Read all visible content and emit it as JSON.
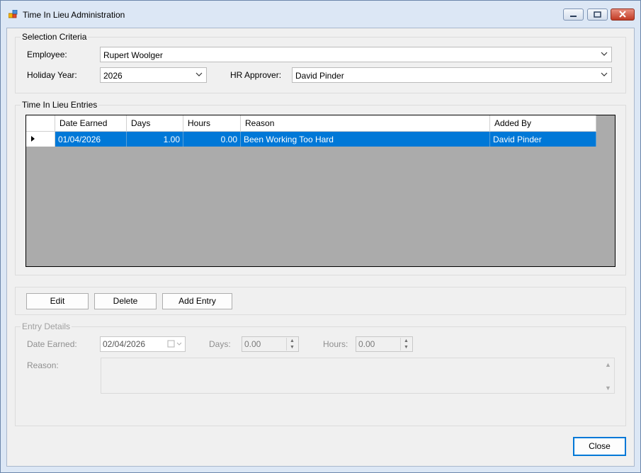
{
  "window": {
    "title": "Time In Lieu Administration"
  },
  "selection": {
    "legend": "Selection Criteria",
    "employee_label": "Employee:",
    "employee_value": "Rupert Woolger",
    "holiday_year_label": "Holiday Year:",
    "holiday_year_value": "2026",
    "hr_approver_label": "HR Approver:",
    "hr_approver_value": "David Pinder"
  },
  "entries": {
    "legend": "Time In Lieu Entries",
    "columns": [
      "Date Earned",
      "Days",
      "Hours",
      "Reason",
      "Added By"
    ],
    "rows": [
      {
        "date_earned": "01/04/2026",
        "days": "1.00",
        "hours": "0.00",
        "reason": "Been Working Too Hard",
        "added_by": "David Pinder"
      }
    ]
  },
  "actions": {
    "edit": "Edit",
    "delete": "Delete",
    "add_entry": "Add Entry"
  },
  "details": {
    "legend": "Entry Details",
    "date_earned_label": "Date Earned:",
    "date_earned_value": "02/04/2026",
    "days_label": "Days:",
    "days_value": "0.00",
    "hours_label": "Hours:",
    "hours_value": "0.00",
    "reason_label": "Reason:"
  },
  "footer": {
    "close": "Close"
  }
}
